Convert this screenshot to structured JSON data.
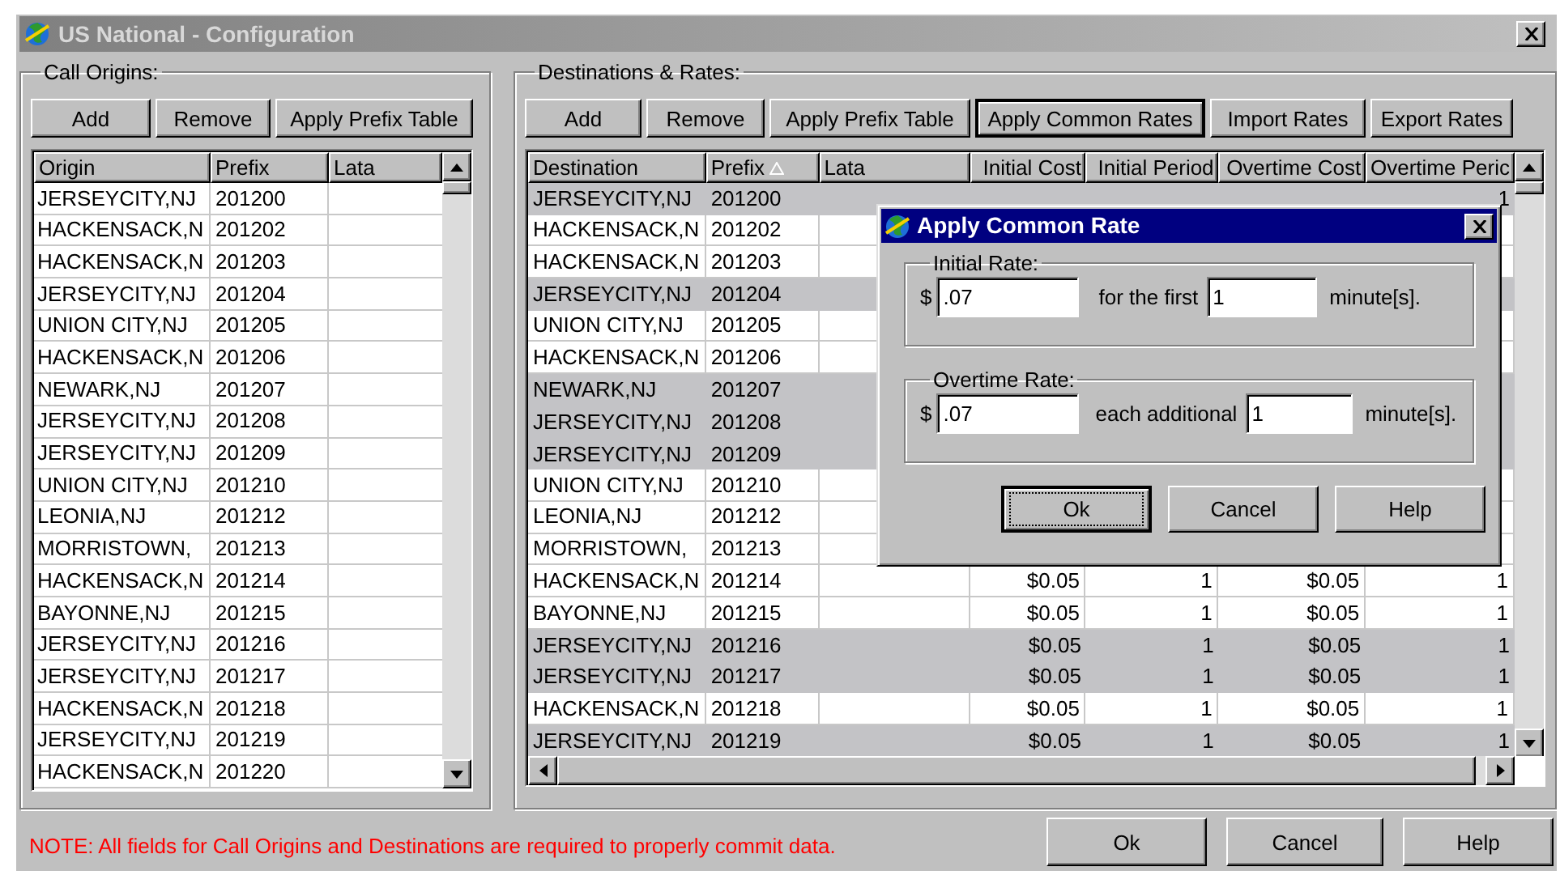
{
  "window": {
    "title": "US National - Configuration"
  },
  "call_origins": {
    "title": "Call Origins:",
    "buttons": [
      "Add",
      "Remove",
      "Apply Prefix Table"
    ],
    "table": {
      "columns": [
        "Origin",
        "Prefix",
        "Lata"
      ],
      "rows": [
        {
          "origin": "JERSEYCITY,NJ",
          "prefix": "201200"
        },
        {
          "origin": "HACKENSACK,N",
          "prefix": "201202"
        },
        {
          "origin": "HACKENSACK,N",
          "prefix": "201203"
        },
        {
          "origin": "JERSEYCITY,NJ",
          "prefix": "201204"
        },
        {
          "origin": "UNION CITY,NJ",
          "prefix": "201205"
        },
        {
          "origin": "HACKENSACK,N",
          "prefix": "201206"
        },
        {
          "origin": "NEWARK,NJ",
          "prefix": "201207"
        },
        {
          "origin": "JERSEYCITY,NJ",
          "prefix": "201208"
        },
        {
          "origin": "JERSEYCITY,NJ",
          "prefix": "201209"
        },
        {
          "origin": "UNION CITY,NJ",
          "prefix": "201210"
        },
        {
          "origin": "LEONIA,NJ",
          "prefix": "201212"
        },
        {
          "origin": "MORRISTOWN,",
          "prefix": "201213"
        },
        {
          "origin": "HACKENSACK,N",
          "prefix": "201214"
        },
        {
          "origin": "BAYONNE,NJ",
          "prefix": "201215"
        },
        {
          "origin": "JERSEYCITY,NJ",
          "prefix": "201216"
        },
        {
          "origin": "JERSEYCITY,NJ",
          "prefix": "201217"
        },
        {
          "origin": "HACKENSACK,N",
          "prefix": "201218"
        },
        {
          "origin": "JERSEYCITY,NJ",
          "prefix": "201219"
        },
        {
          "origin": "HACKENSACK,N",
          "prefix": "201220"
        }
      ]
    }
  },
  "destinations": {
    "title": "Destinations & Rates:",
    "buttons": [
      {
        "label": "Add",
        "default": false
      },
      {
        "label": "Remove",
        "default": false
      },
      {
        "label": "Apply Prefix Table",
        "default": false
      },
      {
        "label": "Apply Common Rates",
        "default": true
      },
      {
        "label": "Import Rates",
        "default": false
      },
      {
        "label": "Export Rates",
        "default": false
      }
    ],
    "table": {
      "columns": [
        {
          "label": "Destination",
          "sorted": false
        },
        {
          "label": "Prefix",
          "sorted": true
        },
        {
          "label": "Lata",
          "sorted": false
        },
        {
          "label": "Initial Cost",
          "sorted": false
        },
        {
          "label": "Initial Period",
          "sorted": false
        },
        {
          "label": "Overtime Cost",
          "sorted": false
        },
        {
          "label": "Overtime Peric",
          "sorted": false
        }
      ],
      "rows": [
        {
          "selected": true,
          "destination": "JERSEYCITY,NJ",
          "prefix": "201200",
          "overtime_period": "1"
        },
        {
          "selected": false,
          "destination": "HACKENSACK,N",
          "prefix": "201202"
        },
        {
          "selected": false,
          "destination": "HACKENSACK,N",
          "prefix": "201203"
        },
        {
          "selected": true,
          "destination": "JERSEYCITY,NJ",
          "prefix": "201204"
        },
        {
          "selected": false,
          "destination": "UNION CITY,NJ",
          "prefix": "201205"
        },
        {
          "selected": false,
          "destination": "HACKENSACK,N",
          "prefix": "201206"
        },
        {
          "selected": true,
          "destination": "NEWARK,NJ",
          "prefix": "201207"
        },
        {
          "selected": true,
          "destination": "JERSEYCITY,NJ",
          "prefix": "201208"
        },
        {
          "selected": true,
          "destination": "JERSEYCITY,NJ",
          "prefix": "201209"
        },
        {
          "selected": false,
          "destination": "UNION CITY,NJ",
          "prefix": "201210"
        },
        {
          "selected": false,
          "destination": "LEONIA,NJ",
          "prefix": "201212"
        },
        {
          "selected": false,
          "destination": "MORRISTOWN,",
          "prefix": "201213"
        },
        {
          "selected": false,
          "destination": "HACKENSACK,N",
          "prefix": "201214",
          "initial_cost": "$0.05",
          "initial_period": "1",
          "overtime_cost": "$0.05",
          "overtime_period": "1"
        },
        {
          "selected": false,
          "destination": "BAYONNE,NJ",
          "prefix": "201215",
          "initial_cost": "$0.05",
          "initial_period": "1",
          "overtime_cost": "$0.05",
          "overtime_period": "1"
        },
        {
          "selected": true,
          "destination": "JERSEYCITY,NJ",
          "prefix": "201216",
          "initial_cost": "$0.05",
          "initial_period": "1",
          "overtime_cost": "$0.05",
          "overtime_period": "1"
        },
        {
          "selected": true,
          "destination": "JERSEYCITY,NJ",
          "prefix": "201217",
          "initial_cost": "$0.05",
          "initial_period": "1",
          "overtime_cost": "$0.05",
          "overtime_period": "1"
        },
        {
          "selected": false,
          "destination": "HACKENSACK,N",
          "prefix": "201218",
          "initial_cost": "$0.05",
          "initial_period": "1",
          "overtime_cost": "$0.05",
          "overtime_period": "1"
        },
        {
          "selected": true,
          "destination": "JERSEYCITY,NJ",
          "prefix": "201219",
          "initial_cost": "$0.05",
          "initial_period": "1",
          "overtime_cost": "$0.05",
          "overtime_period": "1"
        }
      ]
    }
  },
  "dialog": {
    "title": "Apply Common Rate",
    "groups": [
      {
        "title": "Initial Rate:",
        "currency": "$",
        "rate": ".07",
        "label": "for the first",
        "period": "1",
        "unit": "minute[s]."
      },
      {
        "title": "Overtime Rate:",
        "currency": "$",
        "rate": ".07",
        "label": "each additional",
        "period": "1",
        "unit": "minute[s]."
      }
    ],
    "buttons": [
      {
        "label": "Ok",
        "default": true
      },
      {
        "label": "Cancel",
        "default": false
      },
      {
        "label": "Help",
        "default": false
      }
    ]
  },
  "note": "NOTE: All fields for Call Origins and Destinations are required to properly commit data.",
  "buttons": [
    "Ok",
    "Cancel",
    "Help"
  ]
}
